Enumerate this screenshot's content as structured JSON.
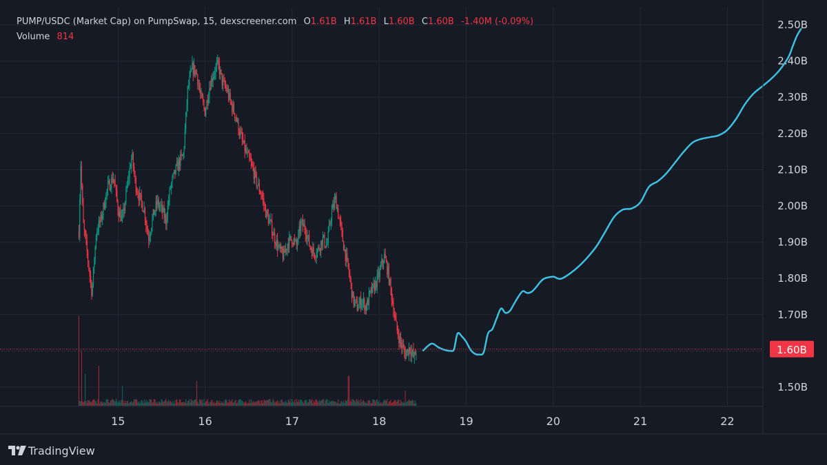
{
  "legend": {
    "symbol": "PUMP/USDC (Market Cap) on PumpSwap, 15, dexscreener.com",
    "open_label": "O",
    "open": "1.61B",
    "high_label": "H",
    "high": "1.61B",
    "low_label": "L",
    "low": "1.60B",
    "close_label": "C",
    "close": "1.60B",
    "change": "-1.40M (-0.09%)",
    "volume_label": "Volume",
    "volume_value": "814"
  },
  "brand": {
    "name": "TradingView",
    "icon": "tradingview-logo-icon"
  },
  "colors": {
    "background": "#161a25",
    "up": "#089981",
    "down": "#f23645",
    "projection": "#3ec1e0",
    "text": "#d1d4dc",
    "grid": "#242836"
  },
  "chart_data": {
    "type": "candlestick",
    "x_tick_labels": [
      "15",
      "16",
      "17",
      "18",
      "19",
      "20",
      "21",
      "22"
    ],
    "y_tick_labels": [
      "2.50B",
      "2.40B",
      "2.30B",
      "2.20B",
      "2.10B",
      "2.00B",
      "1.90B",
      "1.80B",
      "1.70B",
      "1.60B",
      "1.50B"
    ],
    "ylim": [
      1.45,
      2.52
    ],
    "current_price_label": "1.60B",
    "current_price": 1.605,
    "price_path": [
      [
        14.55,
        1.93
      ],
      [
        14.57,
        2.12
      ],
      [
        14.6,
        1.95
      ],
      [
        14.65,
        1.86
      ],
      [
        14.7,
        1.76
      ],
      [
        14.75,
        1.93
      ],
      [
        14.8,
        1.96
      ],
      [
        14.88,
        2.05
      ],
      [
        14.95,
        2.08
      ],
      [
        15.0,
        1.99
      ],
      [
        15.05,
        1.96
      ],
      [
        15.12,
        2.08
      ],
      [
        15.16,
        2.14
      ],
      [
        15.2,
        2.06
      ],
      [
        15.25,
        2.02
      ],
      [
        15.3,
        1.99
      ],
      [
        15.35,
        1.91
      ],
      [
        15.4,
        1.97
      ],
      [
        15.45,
        2.01
      ],
      [
        15.5,
        1.99
      ],
      [
        15.55,
        1.96
      ],
      [
        15.6,
        2.05
      ],
      [
        15.65,
        2.09
      ],
      [
        15.7,
        2.12
      ],
      [
        15.75,
        2.14
      ],
      [
        15.8,
        2.32
      ],
      [
        15.85,
        2.38
      ],
      [
        15.9,
        2.37
      ],
      [
        15.95,
        2.3
      ],
      [
        16.0,
        2.26
      ],
      [
        16.05,
        2.33
      ],
      [
        16.1,
        2.37
      ],
      [
        16.15,
        2.39
      ],
      [
        16.2,
        2.34
      ],
      [
        16.25,
        2.32
      ],
      [
        16.3,
        2.28
      ],
      [
        16.35,
        2.25
      ],
      [
        16.4,
        2.2
      ],
      [
        16.45,
        2.16
      ],
      [
        16.5,
        2.13
      ],
      [
        16.55,
        2.1
      ],
      [
        16.6,
        2.06
      ],
      [
        16.65,
        2.03
      ],
      [
        16.7,
        1.98
      ],
      [
        16.75,
        1.95
      ],
      [
        16.8,
        1.91
      ],
      [
        16.85,
        1.88
      ],
      [
        16.9,
        1.86
      ],
      [
        16.95,
        1.9
      ],
      [
        17.0,
        1.91
      ],
      [
        17.05,
        1.89
      ],
      [
        17.1,
        1.95
      ],
      [
        17.15,
        1.94
      ],
      [
        17.2,
        1.89
      ],
      [
        17.25,
        1.87
      ],
      [
        17.3,
        1.88
      ],
      [
        17.35,
        1.91
      ],
      [
        17.4,
        1.89
      ],
      [
        17.45,
        1.98
      ],
      [
        17.5,
        2.02
      ],
      [
        17.55,
        1.95
      ],
      [
        17.6,
        1.88
      ],
      [
        17.65,
        1.82
      ],
      [
        17.7,
        1.74
      ],
      [
        17.75,
        1.72
      ],
      [
        17.8,
        1.74
      ],
      [
        17.85,
        1.72
      ],
      [
        17.9,
        1.76
      ],
      [
        17.95,
        1.78
      ],
      [
        18.0,
        1.81
      ],
      [
        18.03,
        1.84
      ],
      [
        18.06,
        1.86
      ],
      [
        18.1,
        1.82
      ],
      [
        18.15,
        1.74
      ],
      [
        18.2,
        1.66
      ],
      [
        18.25,
        1.62
      ],
      [
        18.3,
        1.59
      ],
      [
        18.35,
        1.61
      ],
      [
        18.4,
        1.58
      ],
      [
        18.43,
        1.605
      ]
    ],
    "projection_line": [
      [
        18.5,
        1.6
      ],
      [
        18.6,
        1.62
      ],
      [
        18.68,
        1.61
      ],
      [
        18.75,
        1.603
      ],
      [
        18.82,
        1.6
      ],
      [
        18.86,
        1.605
      ],
      [
        18.9,
        1.648
      ],
      [
        18.95,
        1.64
      ],
      [
        19.0,
        1.625
      ],
      [
        19.05,
        1.603
      ],
      [
        19.1,
        1.592
      ],
      [
        19.15,
        1.59
      ],
      [
        19.2,
        1.596
      ],
      [
        19.25,
        1.648
      ],
      [
        19.3,
        1.66
      ],
      [
        19.35,
        1.69
      ],
      [
        19.4,
        1.717
      ],
      [
        19.45,
        1.705
      ],
      [
        19.5,
        1.71
      ],
      [
        19.55,
        1.73
      ],
      [
        19.6,
        1.75
      ],
      [
        19.65,
        1.765
      ],
      [
        19.7,
        1.76
      ],
      [
        19.75,
        1.763
      ],
      [
        19.8,
        1.775
      ],
      [
        19.85,
        1.79
      ],
      [
        19.9,
        1.8
      ],
      [
        20.0,
        1.805
      ],
      [
        20.05,
        1.8
      ],
      [
        20.1,
        1.8
      ],
      [
        20.2,
        1.815
      ],
      [
        20.3,
        1.835
      ],
      [
        20.4,
        1.86
      ],
      [
        20.5,
        1.89
      ],
      [
        20.6,
        1.93
      ],
      [
        20.7,
        1.97
      ],
      [
        20.8,
        1.99
      ],
      [
        20.9,
        1.993
      ],
      [
        21.0,
        2.01
      ],
      [
        21.1,
        2.053
      ],
      [
        21.2,
        2.068
      ],
      [
        21.3,
        2.09
      ],
      [
        21.4,
        2.12
      ],
      [
        21.5,
        2.15
      ],
      [
        21.6,
        2.175
      ],
      [
        21.7,
        2.185
      ],
      [
        21.8,
        2.19
      ],
      [
        21.9,
        2.195
      ],
      [
        22.0,
        2.21
      ],
      [
        22.1,
        2.24
      ],
      [
        22.2,
        2.28
      ],
      [
        22.3,
        2.31
      ],
      [
        22.4,
        2.33
      ],
      [
        22.5,
        2.35
      ],
      [
        22.6,
        2.375
      ],
      [
        22.7,
        2.41
      ],
      [
        22.75,
        2.44
      ],
      [
        22.8,
        2.47
      ],
      [
        22.85,
        2.49
      ]
    ],
    "volume_spikes": [
      [
        14.55,
        0.9
      ],
      [
        14.58,
        0.55
      ],
      [
        14.62,
        0.32
      ],
      [
        14.78,
        0.4
      ],
      [
        15.05,
        0.2
      ],
      [
        15.9,
        0.25
      ],
      [
        17.65,
        0.3
      ],
      [
        18.3,
        0.15
      ]
    ],
    "grid": true
  }
}
